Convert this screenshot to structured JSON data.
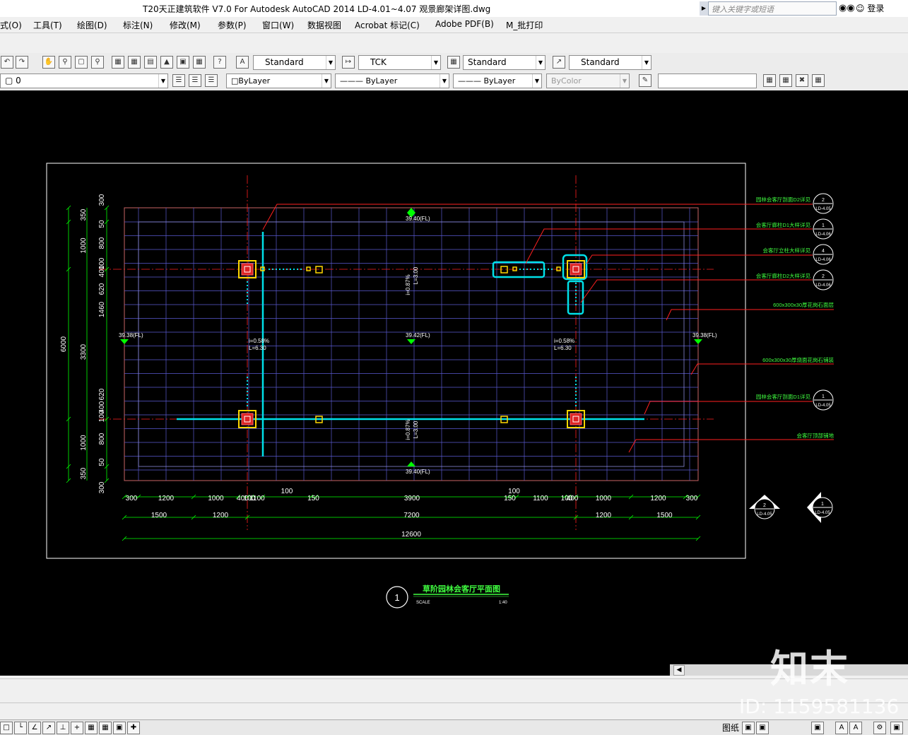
{
  "window": {
    "title": "T20天正建筑软件 V7.0 For Autodesk AutoCAD 2014    LD-4.01~4.07 观景廊架详图.dwg",
    "search_placeholder": "键入关键字或短语",
    "login": "登录"
  },
  "menu": [
    "式(O)",
    "工具(T)",
    "绘图(D)",
    "标注(N)",
    "修改(M)",
    "参数(P)",
    "窗口(W)",
    "数据视图",
    "Acrobat 标记(C)",
    "Adobe PDF(B)",
    "M_批打印"
  ],
  "toolbar1": {
    "text_style": "Standard",
    "dim_style": "TCK",
    "table_style": "Standard",
    "mleader_style": "Standard"
  },
  "toolbar2": {
    "layer": "0",
    "color": "ByLayer",
    "linetype": "ByLayer",
    "lineweight": "ByLayer",
    "plotstyle": "ByColor"
  },
  "drawing": {
    "elevations": [
      "39.40(FL)",
      "39.38(FL)",
      "39.42(FL)",
      "39.38(FL)",
      "39.40(FL)"
    ],
    "slopes": [
      "i=0.58%",
      "L=6.30",
      "i=0.58%",
      "L=6.30",
      "i=0.87%",
      "L=3.00",
      "i=0.87%",
      "L=3.00"
    ],
    "dims_bottom_row1": [
      "300",
      "1200",
      "1000",
      "400",
      "100",
      "1100",
      "100",
      "150",
      "3900",
      "150",
      "100",
      "1100",
      "100",
      "400",
      "1000",
      "1200",
      "300"
    ],
    "dims_bottom_row2": [
      "1500",
      "1200",
      "7200",
      "1200",
      "1500"
    ],
    "dims_bottom_total": "12600",
    "dims_left_outer": [
      "300",
      "350",
      "1000",
      "6000",
      "1000",
      "350",
      "300"
    ],
    "dims_left_inner": [
      "50",
      "800",
      "100",
      "400",
      "620",
      "1460",
      "3300",
      "620",
      "400",
      "100",
      "800",
      "50"
    ],
    "annotations": [
      {
        "text": "园林会客厅剖面D2详见",
        "sym_num": "2",
        "sym_ref": "LD-4.05"
      },
      {
        "text": "会客厅廊柱D1大样详见",
        "sym_num": "1",
        "sym_ref": "LD-4.06"
      },
      {
        "text": "会客厅立柱大样详见",
        "sym_num": "4",
        "sym_ref": "LD-4.06"
      },
      {
        "text": "会客厅廊柱D2大样详见",
        "sym_num": "2",
        "sym_ref": "LD-4.06"
      },
      {
        "text": "600x300x30厚花岗石面层"
      },
      {
        "text": "600x300x30厚烧面花岗石铺装"
      },
      {
        "text": "园林会客厅剖面D1详见",
        "sym_num": "1",
        "sym_ref": "LD-4.05"
      },
      {
        "text": "会客厅顶部铺地"
      }
    ],
    "section_markers": [
      {
        "num": "2",
        "ref": "LD-4.05"
      },
      {
        "num": "1",
        "ref": "LD-4.05"
      }
    ],
    "plan_title": {
      "num": "1",
      "title": "草阶园林会客厅平面图",
      "scale_label": "SCALE",
      "scale": "1:40"
    }
  },
  "status": {
    "paper": "图纸"
  },
  "watermark": {
    "brand": "知末",
    "id": "ID: 1159581136"
  },
  "colors": {
    "canvas": "#000000",
    "dim": "#00ff00",
    "axis": "#ff2020",
    "highlight": "#00e0e8",
    "grid": "#6a6ad8",
    "column": "#ff3030",
    "annotation": "#40ff40"
  }
}
